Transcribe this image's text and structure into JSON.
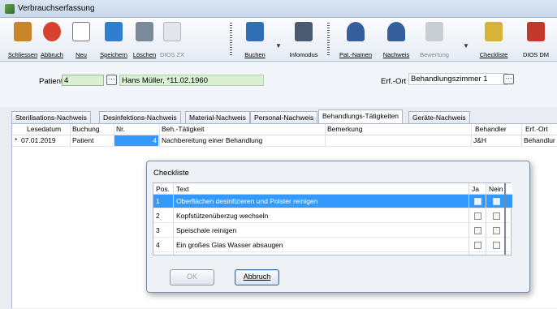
{
  "window": {
    "title": "Verbrauchserfassung"
  },
  "toolbar": {
    "items": [
      {
        "label": "Schliessen",
        "icon": "exit-door-icon",
        "color": "#c9852c"
      },
      {
        "label": "Abbruch",
        "icon": "cancel-icon",
        "color": "#d8412f"
      },
      {
        "label": "Neu",
        "icon": "new-document-icon",
        "color": "#ffffff"
      },
      {
        "label": "Speichern",
        "icon": "save-icon",
        "color": "#2f7fd1"
      },
      {
        "label": "Löschen",
        "icon": "delete-icon",
        "color": "#7a8a99"
      },
      {
        "label": "DIOS ZX",
        "icon": "dios-zx-logo-icon",
        "color": "#9aa3ad"
      },
      {
        "label": "Buchen",
        "icon": "book-icon",
        "color": "#2f6fb6"
      },
      {
        "label": "Infomodus",
        "icon": "info-device-icon",
        "color": "#4a5a70"
      },
      {
        "label": "Pat.-Namen",
        "icon": "patient-names-icon",
        "color": "#355e9c"
      },
      {
        "label": "Nachweis",
        "icon": "person-proof-icon",
        "color": "#355e9c"
      },
      {
        "label": "Bewertung",
        "icon": "rating-chart-icon",
        "color": "#aeb6c0"
      },
      {
        "label": "Checkliste",
        "icon": "checklist-icon",
        "color": "#d8b33a"
      },
      {
        "label": "DIOS DM",
        "icon": "dios-dm-icon",
        "color": "#c0392b"
      }
    ]
  },
  "form": {
    "patient_label": "Patient",
    "patient_value": "4",
    "patient_name": "Hans Müller, *11.02.1960",
    "erfort_label": "Erf.-Ort",
    "erfort_value": "Behandlungszimmer 1"
  },
  "tabs": [
    {
      "label": "Sterilisations-Nachweis"
    },
    {
      "label": "Desinfektions-Nachweis"
    },
    {
      "label": "Material-Nachweis"
    },
    {
      "label": "Personal-Nachweis"
    },
    {
      "label": "Behandlungs-Tätigkeiten"
    },
    {
      "label": "Geräte-Nachweis"
    }
  ],
  "table": {
    "headers": [
      "Lesedatum",
      "Buchung",
      "Nr.",
      "Beh.-Tätigkeit",
      "Bemerkung",
      "Behandler",
      "Erf.-Ort"
    ],
    "rows": [
      {
        "marker": "*",
        "date": "07.01.2019",
        "buchung": "Patient",
        "nr": "4",
        "taetigkeit": "Nachbereitung einer Behandlung",
        "bemerkung": "",
        "behandler": "J&H",
        "erfort": "Behandlur"
      }
    ]
  },
  "dialog": {
    "title": "Checkliste",
    "headers": [
      "Pos.",
      "Text",
      "Ja",
      "Nein"
    ],
    "items": [
      {
        "pos": "1",
        "text": "Oberflächen desinfizieren und Polster reinigen"
      },
      {
        "pos": "2",
        "text": "Kopfstützenüberzug wechseln"
      },
      {
        "pos": "3",
        "text": "Speischale reinigen"
      },
      {
        "pos": "4",
        "text": "Ein großes Glas Wasser absaugen"
      }
    ],
    "ok_label": "OK",
    "cancel_label": "Abbruch"
  }
}
